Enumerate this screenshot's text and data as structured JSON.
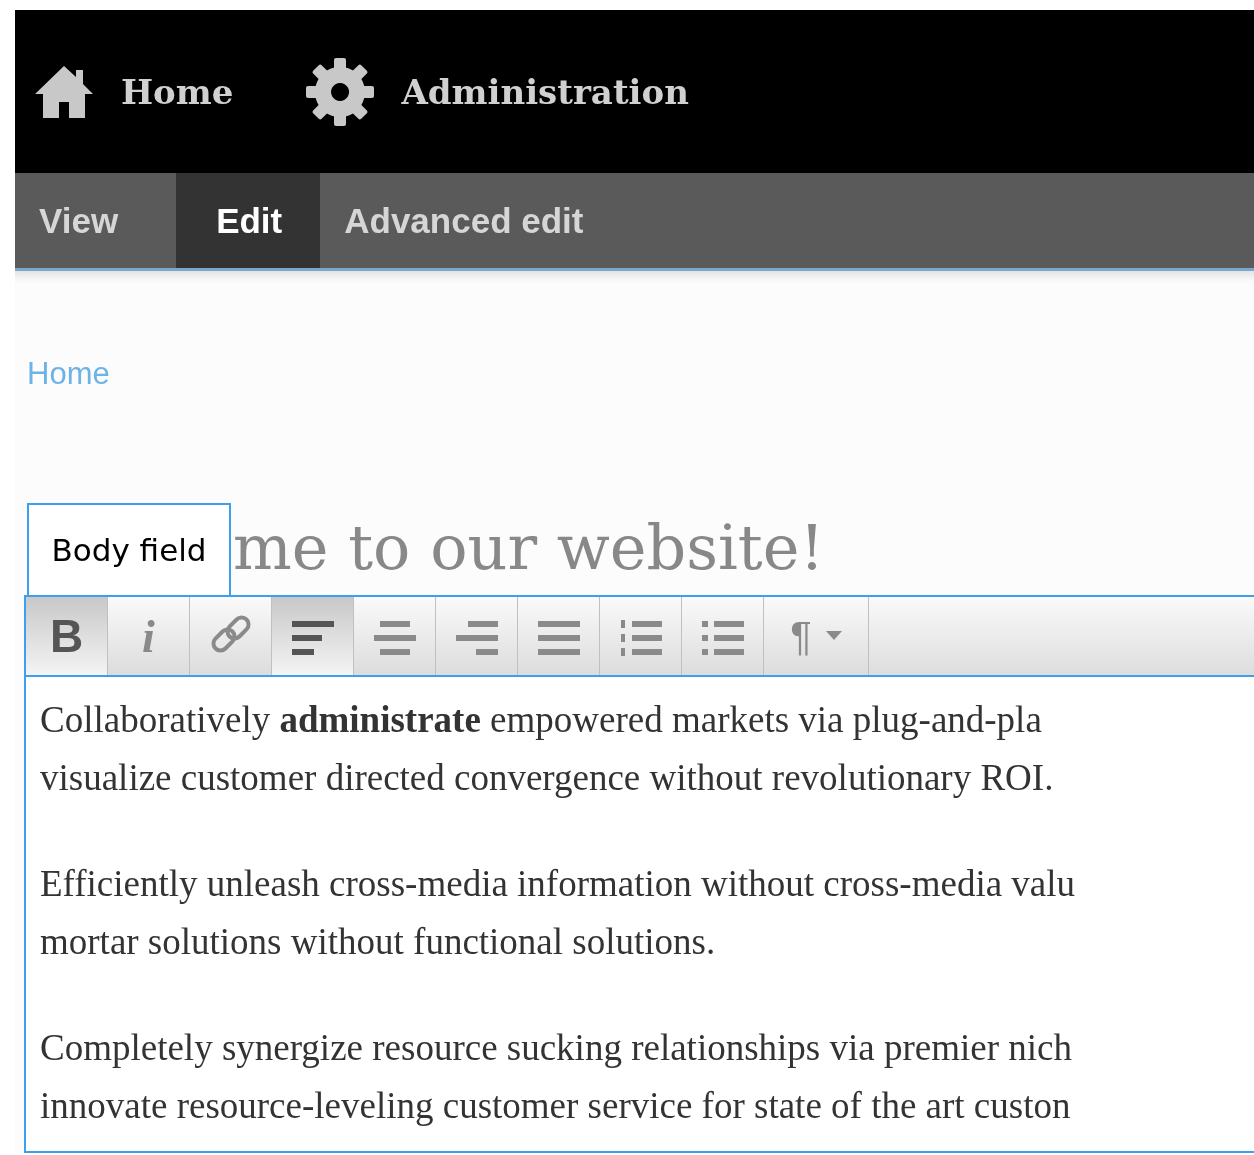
{
  "top_nav": [
    {
      "kind": "home",
      "label": "Home"
    },
    {
      "kind": "gear",
      "label": "Administration"
    }
  ],
  "tabs": [
    {
      "label": "View",
      "selected": false
    },
    {
      "label": "Edit",
      "selected": true
    },
    {
      "label": "Advanced edit",
      "selected": false
    }
  ],
  "breadcrumb": [
    "Home"
  ],
  "page_title": "me to our website!",
  "field_label": "Body field",
  "toolbar": [
    {
      "kind": "bold",
      "label": "B",
      "active": true
    },
    {
      "kind": "italic",
      "label": "i",
      "active": false
    },
    {
      "kind": "link",
      "active": false
    },
    {
      "kind": "align-left",
      "active": true
    },
    {
      "kind": "align-center",
      "active": false
    },
    {
      "kind": "align-right",
      "active": false
    },
    {
      "kind": "justify",
      "active": false
    },
    {
      "kind": "numbered-list",
      "active": false
    },
    {
      "kind": "bulleted-list",
      "active": false
    },
    {
      "kind": "format",
      "label": "¶",
      "active": false
    }
  ],
  "paragraphs": [
    [
      "Collaboratively **administrate** empowered markets via plug-and-pla",
      "visualize customer directed convergence without revolutionary ROI."
    ],
    [
      "Efficiently unleash cross-media information without cross-media valu",
      "mortar solutions without functional solutions."
    ],
    [
      "Completely synergize resource sucking relationships via premier nich",
      "innovate resource-leveling customer service for state of the art custon"
    ]
  ]
}
